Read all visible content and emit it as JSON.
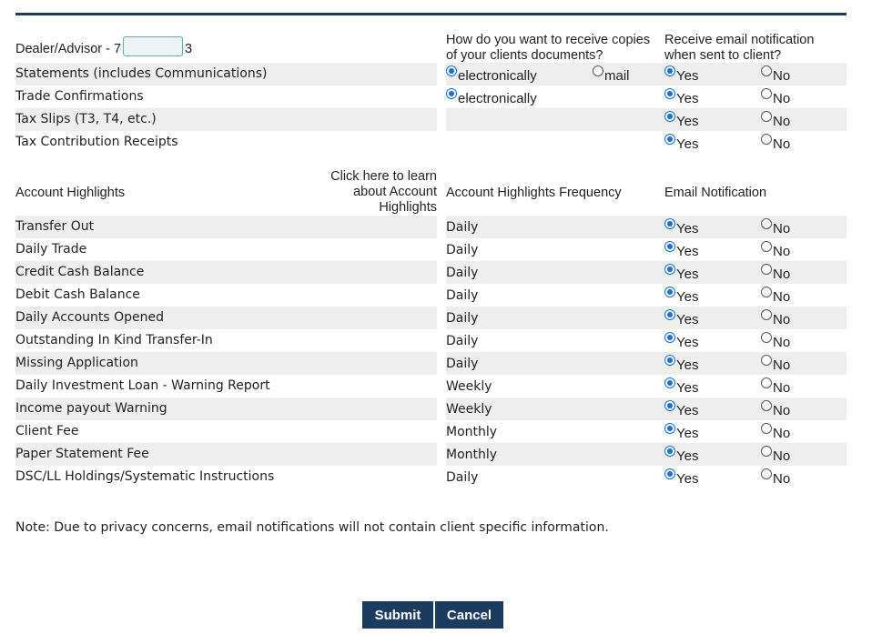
{
  "dealer": {
    "prefix": "Dealer/Advisor - 7",
    "suffix": "3",
    "field_value": ""
  },
  "headers": {
    "receive_copies": "How do you want to receive copies of your clients documents?",
    "email_notification_client": "Receive email notification when sent to client?",
    "account_highlights": "Account Highlights",
    "learn_link": "Click here to learn about Account Highlights",
    "frequency": "Account Highlights Frequency",
    "email_notification": "Email Notification"
  },
  "options": {
    "electronically": "electronically",
    "mail": "mail",
    "yes": "Yes",
    "no": "No"
  },
  "document_rows": [
    {
      "label": "Statements (includes Communications)",
      "delivery": "electronically",
      "show_mail": true,
      "email": "Yes"
    },
    {
      "label": "Trade Confirmations",
      "delivery": "electronically",
      "show_mail": false,
      "email": "Yes"
    },
    {
      "label": "Tax Slips (T3, T4, etc.)",
      "delivery": "",
      "show_mail": false,
      "email": "Yes"
    },
    {
      "label": "Tax Contribution Receipts",
      "delivery": "",
      "show_mail": false,
      "email": "Yes"
    }
  ],
  "highlight_rows": [
    {
      "label": "Transfer Out",
      "frequency": "Daily",
      "email": "Yes"
    },
    {
      "label": "Daily Trade",
      "frequency": "Daily",
      "email": "Yes"
    },
    {
      "label": "Credit Cash Balance",
      "frequency": "Daily",
      "email": "Yes"
    },
    {
      "label": "Debit Cash Balance",
      "frequency": "Daily",
      "email": "Yes"
    },
    {
      "label": "Daily Accounts Opened",
      "frequency": "Daily",
      "email": "Yes"
    },
    {
      "label": "Outstanding In Kind Transfer-In",
      "frequency": "Daily",
      "email": "Yes"
    },
    {
      "label": "Missing Application",
      "frequency": "Daily",
      "email": "Yes"
    },
    {
      "label": "Daily Investment Loan - Warning Report",
      "frequency": "Weekly",
      "email": "Yes"
    },
    {
      "label": "Income payout Warning",
      "frequency": "Weekly",
      "email": "Yes"
    },
    {
      "label": "Client Fee",
      "frequency": "Monthly",
      "email": "Yes"
    },
    {
      "label": "Paper Statement Fee",
      "frequency": "Monthly",
      "email": "Yes"
    },
    {
      "label": "DSC/LL Holdings/Systematic Instructions",
      "frequency": "Daily",
      "email": "Yes"
    }
  ],
  "note": "Note: Due to privacy concerns, email notifications will not contain client specific information.",
  "buttons": {
    "submit": "Submit",
    "cancel": "Cancel"
  },
  "colors": {
    "brand": "#1b3c5e",
    "radio_selected": "#1a6fd0",
    "row_shade": "#eeeeee"
  }
}
